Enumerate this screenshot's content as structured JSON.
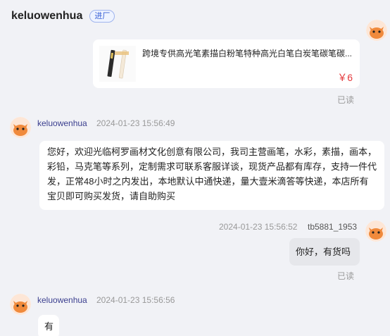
{
  "header": {
    "title": "keluowenhua",
    "badge": "进厂"
  },
  "product": {
    "title": "跨境专供高光笔素描白粉笔特种高光白笔白炭笔碳笔碳...",
    "price": "￥6",
    "status": "已读"
  },
  "messages": [
    {
      "sender": "keluowenhua",
      "time": "2024-01-23 15:56:49",
      "text": "您好，欢迎光临柯罗画材文化创意有限公司，我司主营画笔，水彩，素描，画本，彩铅，马克笔等系列，定制需求可联系客服详谈，现货产品都有库存，支持一件代发，正常48小时之内发出，本地默认中通快递，量大壹米滴答等快递，本店所有宝贝即可购买发货，请自助购买"
    },
    {
      "sender": "tb5881_1953",
      "time": "2024-01-23 15:56:52",
      "text": "你好，有货吗",
      "status": "已读"
    },
    {
      "sender": "keluowenhua",
      "time": "2024-01-23 15:56:56",
      "text": "有"
    }
  ],
  "colors": {
    "background": "#f1f2f6",
    "price": "#e4393c",
    "sender_name": "#3b3f8f",
    "avatar_orange": "#f08a3c"
  }
}
